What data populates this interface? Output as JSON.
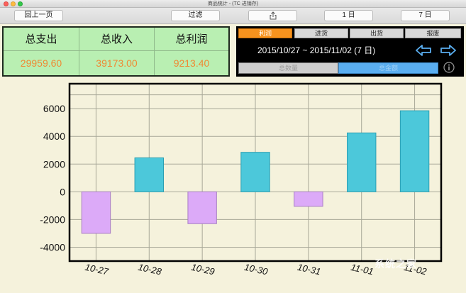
{
  "window": {
    "title": "商品统计 - (TC 进销存)"
  },
  "toolbar": {
    "back_label": "回上一页",
    "filter_label": "过滤",
    "share_icon": "share-icon",
    "one_day_label": "1 日",
    "seven_day_label": "7 日"
  },
  "summary": {
    "total_expense_label": "总支出",
    "total_expense_value": "29959.60",
    "total_income_label": "总收入",
    "total_income_value": "39173.00",
    "total_profit_label": "总利润",
    "total_profit_value": "9213.40"
  },
  "controls": {
    "tabs": [
      {
        "label": "利润",
        "active": true
      },
      {
        "label": "进货",
        "active": false
      },
      {
        "label": "出货",
        "active": false
      },
      {
        "label": "报废",
        "active": false
      }
    ],
    "date_range": "2015/10/27 ~ 2015/11/02 (7 日)",
    "prev_icon": "left-arrow-icon",
    "next_icon": "right-arrow-icon",
    "mode_quantity_label": "总数量",
    "mode_amount_label": "总金额",
    "info_icon": "info-icon"
  },
  "colors": {
    "positive_bar": "#4cc8da",
    "negative_bar": "#dcaaf8",
    "active_tab": "#f7931e",
    "summary_bg": "#b9efb2",
    "summary_value": "#ef8a34",
    "selected_mode": "#5aaef0"
  },
  "chart_data": {
    "type": "bar",
    "categories": [
      "10-27",
      "10-28",
      "10-29",
      "10-30",
      "10-31",
      "11-01",
      "11-02"
    ],
    "values": [
      -3000,
      2450,
      -2300,
      2850,
      -1050,
      4250,
      5850
    ],
    "yticks": [
      "6000",
      "4000",
      "2000",
      "0",
      "-2000",
      "-4000"
    ],
    "ylim": [
      -5000,
      7800
    ],
    "grid": true,
    "title": "",
    "xlabel": "",
    "ylabel": ""
  },
  "watermark": {
    "text": "系统之家"
  }
}
